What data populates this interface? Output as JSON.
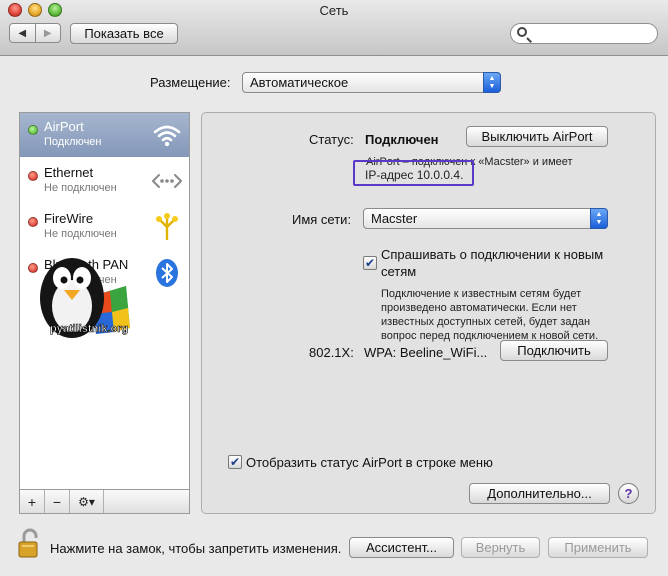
{
  "window": {
    "title": "Сеть"
  },
  "toolbar": {
    "back_label": "◀",
    "forward_label": "▶",
    "show_all_label": "Показать все",
    "search_placeholder": ""
  },
  "location": {
    "label": "Размещение:",
    "value": "Автоматическое"
  },
  "services": [
    {
      "name": "AirPort",
      "status": "Подключен",
      "status_color": "#3fae21",
      "icon": "wifi-icon",
      "selected": true
    },
    {
      "name": "Ethernet",
      "status": "Не подключен",
      "status_color": "#d0261a",
      "icon": "ethernet-icon",
      "selected": false
    },
    {
      "name": "FireWire",
      "status": "Не подключен",
      "status_color": "#d0261a",
      "icon": "firewire-icon",
      "selected": false
    },
    {
      "name": "Bluetooth PAN",
      "status": "Не подключен",
      "status_color": "#d0261a",
      "icon": "bluetooth-icon",
      "selected": false
    }
  ],
  "list_footer": {
    "add_label": "+",
    "remove_label": "−",
    "gear_label": "⚙▾"
  },
  "watermark": {
    "text": "pyatilistnik.org"
  },
  "detail": {
    "status_label": "Статус:",
    "status_value": "Подключен",
    "turn_off_button": "Выключить AirPort",
    "status_desc_line1": "AirPort – подключен к «Macster» и имеет",
    "status_desc_line2": "IP-адрес 10.0.0.4.",
    "network_name_label": "Имя сети:",
    "network_name_value": "Macster",
    "ask_join_label_line1": "Спрашивать о подключении к новым",
    "ask_join_label_line2": "сетям",
    "ask_join_checked": true,
    "ask_join_desc": [
      "Подключение к известным сетям будет",
      "произведено автоматически. Если нет",
      "известных доступных сетей, будет задан",
      "вопрос перед подключением к новой сети."
    ],
    "dot1x_label": "802.1X:",
    "dot1x_value": "WPA: Beeline_WiFi...",
    "connect_button": "Подключить",
    "show_status_label": "Отобразить статус AirPort в строке меню",
    "show_status_checked": true,
    "advanced_button": "Дополнительно...",
    "help_label": "?"
  },
  "bottom": {
    "lock_text": "Нажмите на замок, чтобы запретить изменения.",
    "assistant_button": "Ассистент...",
    "revert_button": "Вернуть",
    "apply_button": "Применить"
  },
  "colors": {
    "accent_blue": "#1b5fd8",
    "highlight_box": "#5a38c8",
    "selection": "#8397b8"
  }
}
